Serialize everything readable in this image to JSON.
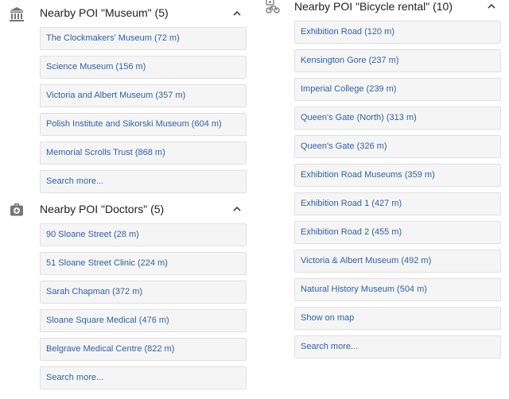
{
  "museum": {
    "title": "Nearby POI \"Museum\" (5)",
    "icon": "museum-icon",
    "items": [
      "The Clockmakers' Museum (72 m)",
      "Science Museum (156 m)",
      "Victoria and Albert Museum (357 m)",
      "Polish Institute and Sikorski Museum (604 m)",
      "Memorial Scrolls Trust (868 m)",
      "Search more..."
    ]
  },
  "doctors": {
    "title": "Nearby POI \"Doctors\" (5)",
    "icon": "medical-bag-icon",
    "items": [
      "90 Sloane Street (28 m)",
      "51 Sloane Street Clinic (224 m)",
      "Sarah Chapman (372 m)",
      "Sloane Square Medical (476 m)",
      "Belgrave Medical Centre (822 m)",
      "Search more..."
    ]
  },
  "bicycle": {
    "title": "Nearby POI \"Bicycle rental\" (10)",
    "icon": "bicycle-rental-icon",
    "items": [
      "Exhibition Road (120 m)",
      "Kensington Gore (237 m)",
      "Imperial College (239 m)",
      "Queen's Gate (North) (313 m)",
      "Queen's Gate (326 m)",
      "Exhibition Road Museums (359 m)",
      "Exhibition Road 1 (427 m)",
      "Exhibition Road 2 (455 m)",
      "Victoria & Albert Museum (492 m)",
      "Natural History Museum (504 m)",
      "Show on map",
      "Search more..."
    ]
  },
  "colors": {
    "link": "#2f61a8",
    "item_background": "#f5f5f5",
    "item_border": "#e0e0e0",
    "title": "#212121",
    "icon": "#757575"
  }
}
